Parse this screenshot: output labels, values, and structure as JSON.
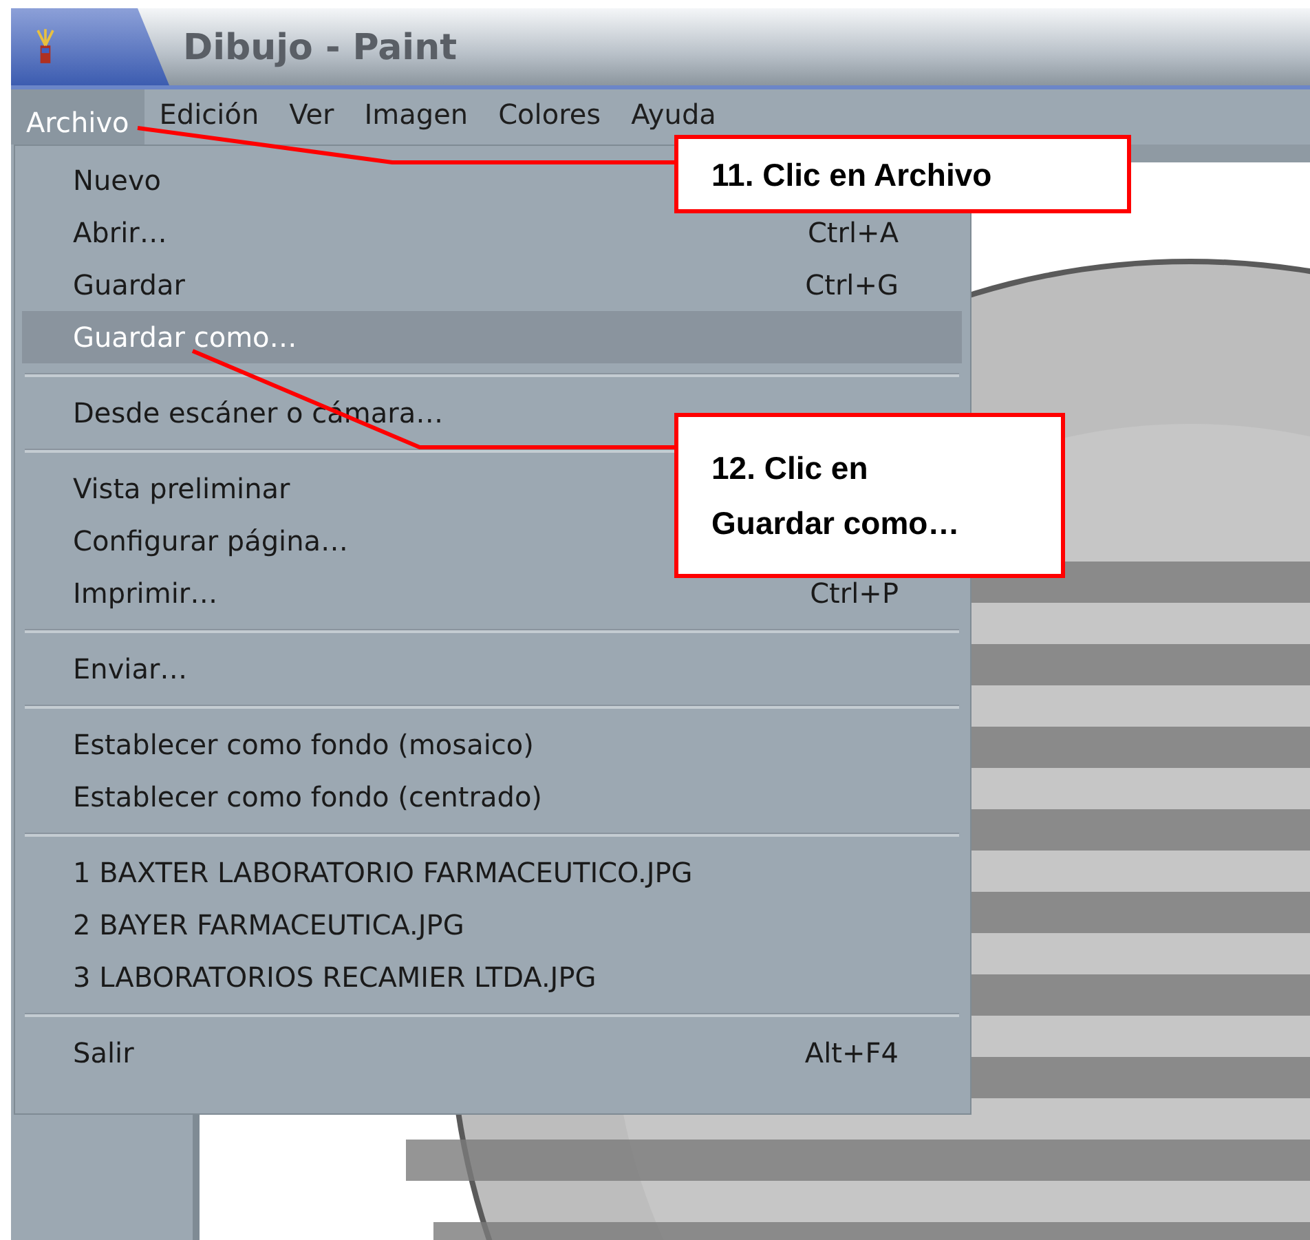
{
  "window": {
    "title": "Dibujo - Paint"
  },
  "menu_bar": [
    {
      "label": "Archivo",
      "selected": true
    },
    {
      "label": "Edición",
      "selected": false
    },
    {
      "label": "Ver",
      "selected": false
    },
    {
      "label": "Imagen",
      "selected": false
    },
    {
      "label": "Colores",
      "selected": false
    },
    {
      "label": "Ayuda",
      "selected": false
    }
  ],
  "file_menu": {
    "sections": [
      {
        "items": [
          {
            "label": "Nuevo",
            "selected": false
          },
          {
            "label": "Abrir…",
            "shortcut": "Ctrl+A",
            "selected": false
          },
          {
            "label": "Guardar",
            "shortcut": "Ctrl+G",
            "selected": false
          },
          {
            "label": "Guardar como…",
            "selected": true
          }
        ]
      },
      {
        "items": [
          {
            "label": "Desde escáner o cámara…",
            "selected": false
          }
        ]
      },
      {
        "items": [
          {
            "label": "Vista preliminar",
            "selected": false
          },
          {
            "label": "Configurar página…",
            "selected": false
          },
          {
            "label": "Imprimir…",
            "shortcut": "Ctrl+P",
            "selected": false
          }
        ]
      },
      {
        "items": [
          {
            "label": "Enviar…",
            "selected": false
          }
        ]
      },
      {
        "items": [
          {
            "label": "Establecer como fondo (mosaico)",
            "selected": false
          },
          {
            "label": "Establecer como fondo (centrado)",
            "selected": false
          }
        ]
      },
      {
        "items": [
          {
            "label": "1 BAXTER LABORATORIO FARMACEUTICO.JPG",
            "selected": false
          },
          {
            "label": "2 BAYER FARMACEUTICA.JPG",
            "selected": false
          },
          {
            "label": "3 LABORATORIOS RECAMIER LTDA.JPG",
            "selected": false
          }
        ]
      },
      {
        "items": [
          {
            "label": "Salir",
            "shortcut": "Alt+F4",
            "selected": false
          }
        ]
      }
    ]
  },
  "callouts": [
    {
      "lines": [
        "11. Clic en Archivo"
      ]
    },
    {
      "lines": [
        "12. Clic en",
        "Guardar como…"
      ]
    }
  ]
}
